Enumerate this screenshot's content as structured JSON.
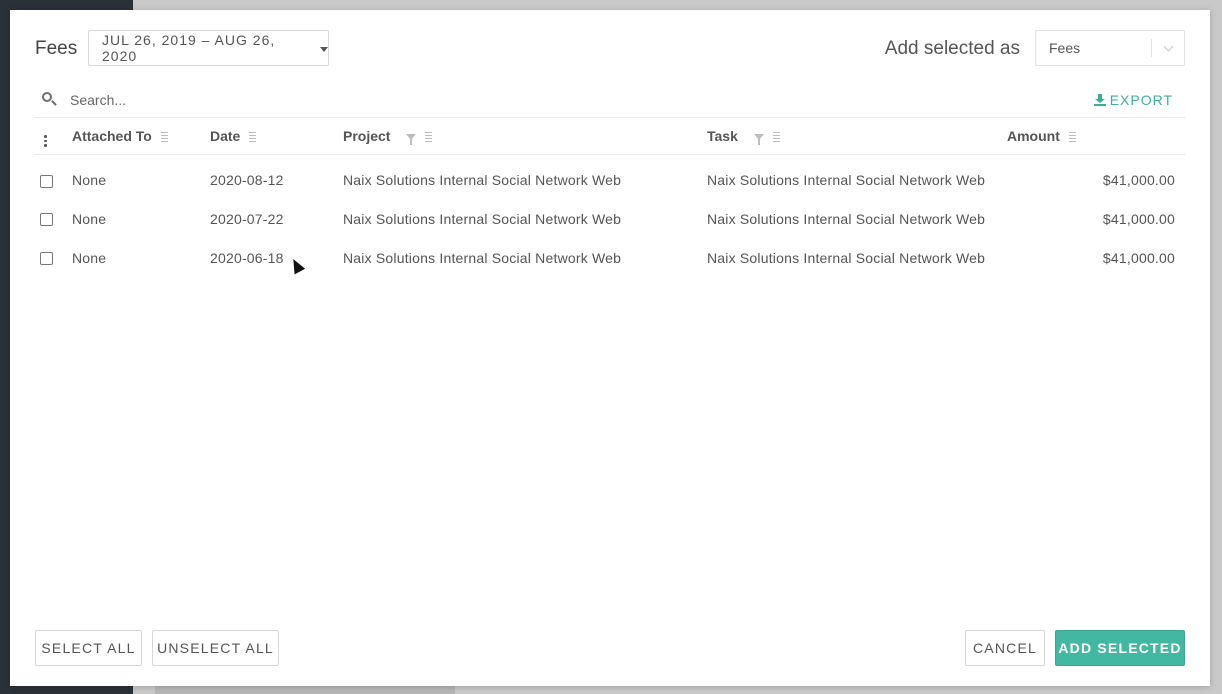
{
  "dialog": {
    "title": "Fees",
    "date_range": "JUL 26, 2019 – AUG 26, 2020",
    "add_selected_as_label": "Add selected as",
    "add_selected_as_value": "Fees"
  },
  "search": {
    "placeholder": "Search...",
    "icon": "search-icon"
  },
  "export": {
    "label": "EXPORT",
    "icon": "download-icon"
  },
  "table": {
    "columns": [
      "Attached To",
      "Date",
      "Project",
      "Task",
      "Amount"
    ],
    "rows": [
      {
        "attached_to": "None",
        "date": "2020-08-12",
        "project": "Naix Solutions Internal Social Network Web",
        "task": "Naix Solutions Internal Social Network Web",
        "amount": "$41,000.00"
      },
      {
        "attached_to": "None",
        "date": "2020-07-22",
        "project": "Naix Solutions Internal Social Network Web",
        "task": "Naix Solutions Internal Social Network Web",
        "amount": "$41,000.00"
      },
      {
        "attached_to": "None",
        "date": "2020-06-18",
        "project": "Naix Solutions Internal Social Network Web",
        "task": "Naix Solutions Internal Social Network Web",
        "amount": "$41,000.00"
      }
    ]
  },
  "footer": {
    "select_all": "SELECT ALL",
    "unselect_all": "UNSELECT ALL",
    "cancel": "CANCEL",
    "add_selected": "ADD SELECTED"
  },
  "colors": {
    "accent": "#42b8a2",
    "export_text": "#3dae9b"
  }
}
